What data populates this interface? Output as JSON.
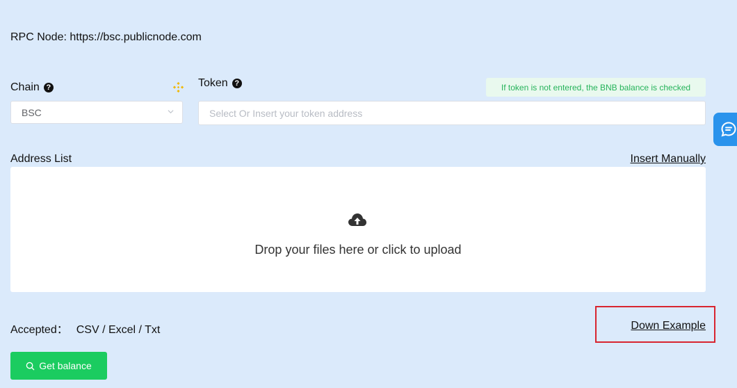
{
  "rpc": {
    "label": "RPC Node: https://bsc.publicnode.com"
  },
  "chain": {
    "label": "Chain",
    "selected": "BSC",
    "icon": "bnb-icon"
  },
  "token": {
    "label": "Token",
    "placeholder": "Select Or Insert your token address",
    "hint": "If token is not entered, the BNB balance is checked"
  },
  "address_list": {
    "label": "Address List",
    "insert_manually": "Insert Manually",
    "upload_text": "Drop your files here or click to upload",
    "upload_icon": "cloud-upload-icon"
  },
  "accepted": {
    "label": "Accepted：",
    "types": "CSV / Excel / Txt"
  },
  "down_example": "Down Example",
  "button": {
    "label": "Get balance",
    "icon": "search-icon"
  },
  "colors": {
    "background": "#dbeafb",
    "button": "#1bcc60",
    "hint_text": "#25b35a",
    "highlight": "#d8242f",
    "chat_tab": "#2a93ec"
  }
}
